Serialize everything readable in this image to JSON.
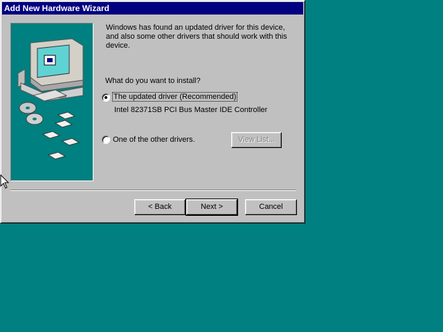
{
  "window": {
    "title": "Add New Hardware Wizard"
  },
  "intro": "Windows has found an updated driver for this device, and also some other drivers that should work with this device.",
  "question": "What do you want to install?",
  "options": [
    {
      "label": "The updated driver (Recommended)",
      "selected": true,
      "detail": "Intel 82371SB PCI Bus Master IDE Controller"
    },
    {
      "label": "One of the other drivers.",
      "selected": false
    }
  ],
  "view_list_label": "View List...",
  "buttons": {
    "back": "< Back",
    "next": "Next >",
    "cancel": "Cancel"
  },
  "colors": {
    "desktop": "#008080",
    "titlebar": "#000080",
    "face": "#c0c0c0"
  }
}
